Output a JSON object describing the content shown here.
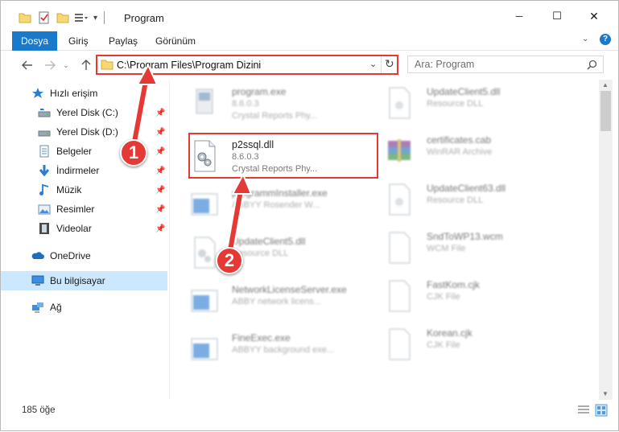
{
  "window": {
    "title": "Program",
    "controls": {
      "minimize": "─",
      "maximize": "☐",
      "close": "✕"
    }
  },
  "ribbon": {
    "tabs": [
      "Dosya",
      "Giriş",
      "Paylaş",
      "Görünüm"
    ]
  },
  "address_bar": {
    "path": "C:\\Program Files\\Program Dizini"
  },
  "search": {
    "placeholder": "Ara: Program"
  },
  "sidebar": {
    "items": [
      {
        "label": "Hızlı erişim",
        "icon": "star-icon"
      },
      {
        "label": "Yerel Disk (C:)",
        "icon": "drive-icon"
      },
      {
        "label": "Yerel Disk (D:)",
        "icon": "drive-icon"
      },
      {
        "label": "Belgeler",
        "icon": "documents-icon"
      },
      {
        "label": "İndirmeler",
        "icon": "download-icon"
      },
      {
        "label": "Müzik",
        "icon": "music-icon"
      },
      {
        "label": "Resimler",
        "icon": "pictures-icon"
      },
      {
        "label": "Videolar",
        "icon": "videos-icon"
      },
      {
        "label": "OneDrive",
        "icon": "cloud-icon"
      },
      {
        "label": "Bu bilgisayar",
        "icon": "computer-icon"
      },
      {
        "label": "Ağ",
        "icon": "network-icon"
      }
    ]
  },
  "files": [
    {
      "name": "program.exe",
      "line1": "8.6.0.3",
      "line2": "Crystal Reports Phy...",
      "icon": "exe-icon"
    },
    {
      "name": "UpdateClient5.dll",
      "line1": "Resource DLL",
      "line2": "",
      "icon": "dll-icon"
    },
    {
      "name": "p2ssql.dll",
      "line1": "8.6.0.3",
      "line2": "Crystal Reports Phy...",
      "icon": "dll-gear-icon"
    },
    {
      "name": "certificates.cab",
      "line1": "WinRAR Archive",
      "line2": "",
      "icon": "rar-icon"
    },
    {
      "name": "programmInstaller.exe",
      "line1": "ABBYY Rosender W...",
      "line2": "",
      "icon": "app-window-icon"
    },
    {
      "name": "UpdateClient63.dll",
      "line1": "Resource DLL",
      "line2": "",
      "icon": "dll-icon"
    },
    {
      "name": "UpdateClient5.dll",
      "line1": "Resource DLL",
      "line2": "",
      "icon": "dll-gear-icon"
    },
    {
      "name": "SndToWP13.wcm",
      "line1": "WCM File",
      "line2": "",
      "icon": "blank-file-icon"
    },
    {
      "name": "NetworkLicenseServer.exe",
      "line1": "ABBY network licens...",
      "line2": "",
      "icon": "app-window-icon"
    },
    {
      "name": "FastKom.cjk",
      "line1": "CJK File",
      "line2": "",
      "icon": "blank-file-icon"
    },
    {
      "name": "FineExec.exe",
      "line1": "ABBYY background exe...",
      "line2": "",
      "icon": "app-window-icon"
    },
    {
      "name": "Korean.cjk",
      "line1": "CJK File",
      "line2": "",
      "icon": "blank-file-icon"
    }
  ],
  "status": {
    "count": "185 öğe"
  },
  "annotations": {
    "step1": "1",
    "step2": "2"
  },
  "colors": {
    "accent": "#1979ca",
    "highlight": "#e53935",
    "selection": "#cce8ff"
  }
}
